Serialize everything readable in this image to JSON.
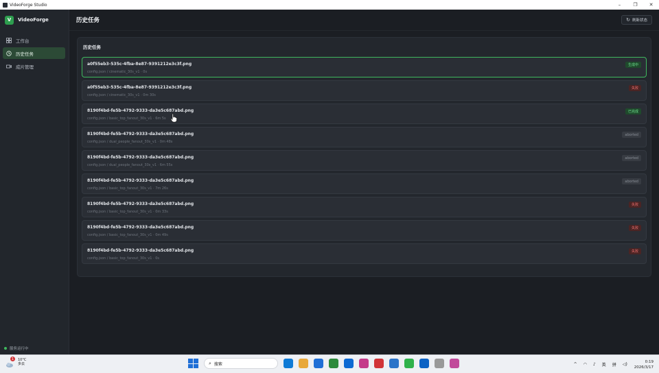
{
  "window": {
    "title": "VideoForge Studio",
    "controls": [
      "–",
      "❐",
      "✕"
    ]
  },
  "sidebar": {
    "brand_letter": "V",
    "brand_name": "VideoForge",
    "items": [
      {
        "label": "工作台",
        "icon": "grid-icon"
      },
      {
        "label": "历史任务",
        "icon": "clock-icon",
        "active": true
      },
      {
        "label": "成片管理",
        "icon": "video-icon"
      }
    ],
    "footer_status": "服务运行中"
  },
  "header": {
    "title": "历史任务",
    "refresh_label": "刷新状态"
  },
  "panel": {
    "title": "历史任务"
  },
  "tasks": [
    {
      "name": "a0f55eb3-535c-4fba-8e87-9391212e3c3f.png",
      "meta": "config.json / cinematic_30s_v1 · 0s",
      "status": "生成中",
      "status_type": "running"
    },
    {
      "name": "a0f55eb3-535c-4fba-8e87-9391212e3c3f.png",
      "meta": "config.json / cinematic_30s_v1 · 0m 30s",
      "status": "失败",
      "status_type": "failed"
    },
    {
      "name": "8190f4bd-fe5b-4792-9333-da3e5c687abd.png",
      "meta": "config.json / basic_top_fanout_30s_v1 · 6m 5s",
      "status": "已完成",
      "status_type": "done"
    },
    {
      "name": "8190f4bd-fe5b-4792-9333-da3e5c687abd.png",
      "meta": "config.json / dual_people_fanout_30s_v1 · 0m 48s",
      "status": "aborted",
      "status_type": "aborted"
    },
    {
      "name": "8190f4bd-fe5b-4792-9333-da3e5c687abd.png",
      "meta": "config.json / dual_people_fanout_30s_v1 · 6m 55s",
      "status": "aborted",
      "status_type": "aborted"
    },
    {
      "name": "8190f4bd-fe5b-4792-9333-da3e5c687abd.png",
      "meta": "config.json / basic_top_fanout_30s_v1 · 7m 26s",
      "status": "aborted",
      "status_type": "aborted"
    },
    {
      "name": "8190f4bd-fe5b-4792-9333-da3e5c687abd.png",
      "meta": "config.json / basic_top_fanout_30s_v1 · 0m 33s",
      "status": "失败",
      "status_type": "failed"
    },
    {
      "name": "8190f4bd-fe5b-4792-9333-da3e5c687abd.png",
      "meta": "config.json / basic_top_fanout_30s_v1 · 0m 49s",
      "status": "失败",
      "status_type": "failed"
    },
    {
      "name": "8190f4bd-fe5b-4792-9333-da3e5c687abd.png",
      "meta": "config.json / basic_top_fanout_30s_v1 · 0s",
      "status": "失败",
      "status_type": "failed"
    }
  ],
  "taskbar": {
    "weather_temp": "10°C",
    "weather_desc": "多云",
    "weather_badge": "1",
    "search_placeholder": "搜索",
    "tray_lang": "英",
    "tray_ime": "拼",
    "clock_time": "0:19",
    "clock_date": "2026/3/17",
    "apps": [
      "#0f7bd6",
      "#e8a83a",
      "#1f6fd6",
      "#2d8a3c",
      "#0d6ad3",
      "#c43b8a",
      "#d13438",
      "#2b74c9",
      "#2fb24b",
      "#0b62c4",
      "#999999",
      "#c14a9b"
    ]
  },
  "colors": {
    "accent": "#3fb95e",
    "failed": "#f07070",
    "panel": "#23272d"
  }
}
